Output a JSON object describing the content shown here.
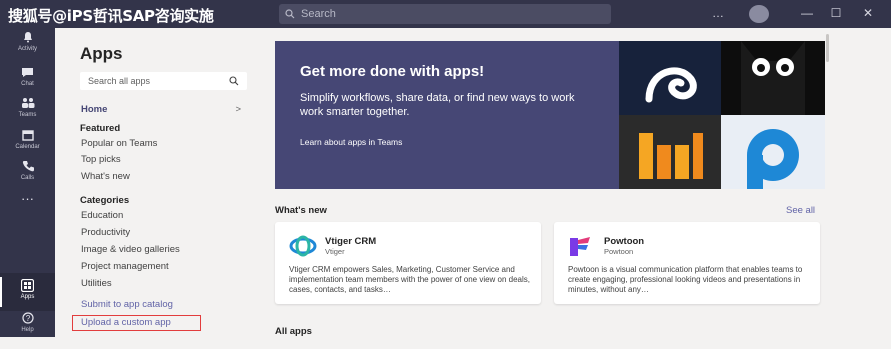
{
  "watermark": "搜狐号@iPS哲讯SAP咨询实施",
  "titlebar": {
    "search_placeholder": "Search",
    "controls": [
      "…",
      "—",
      "☐",
      "✕"
    ]
  },
  "rail": [
    {
      "label": "Activity",
      "icon": "bell-icon"
    },
    {
      "label": "Chat",
      "icon": "chat-icon"
    },
    {
      "label": "Teams",
      "icon": "teams-icon"
    },
    {
      "label": "Calendar",
      "icon": "calendar-icon"
    },
    {
      "label": "Calls",
      "icon": "phone-icon"
    },
    {
      "label": "···",
      "icon": "more-icon"
    },
    {
      "label": "Apps",
      "icon": "apps-icon"
    },
    {
      "label": "Help",
      "icon": "help-icon"
    }
  ],
  "left_panel": {
    "title": "Apps",
    "search_placeholder": "Search all apps",
    "home_label": "Home",
    "home_chevron": ">",
    "featured_heading": "Featured",
    "featured": [
      "Popular on Teams",
      "Top picks",
      "What's new"
    ],
    "categories_heading": "Categories",
    "categories": [
      "Education",
      "Productivity",
      "Image & video galleries",
      "Project management",
      "Utilities"
    ],
    "submit_label": "Submit to app catalog",
    "upload_label": "Upload a custom app"
  },
  "hero": {
    "title": "Get more done with apps!",
    "subtitle": "Simplify workflows, share data, or find new ways to work work smarter together.",
    "learn": "Learn about apps in Teams"
  },
  "whats_new": {
    "heading": "What's new",
    "see_all": "See all",
    "cards": [
      {
        "name": "Vtiger CRM",
        "publisher": "Vtiger",
        "desc": "Vtiger CRM empowers Sales, Marketing, Customer Service and implementation team members with the power of one view on deals, cases, contacts, and tasks…"
      },
      {
        "name": "Powtoon",
        "publisher": "Powtoon",
        "desc": "Powtoon is a visual communication platform that enables teams to create engaging, professional looking videos and presentations in minutes, without any…"
      }
    ]
  },
  "all_apps_heading": "All apps",
  "colors": {
    "rail": "#33344a",
    "accent": "#6264a7",
    "hero": "#464775",
    "highlight": "#e23d3d"
  }
}
